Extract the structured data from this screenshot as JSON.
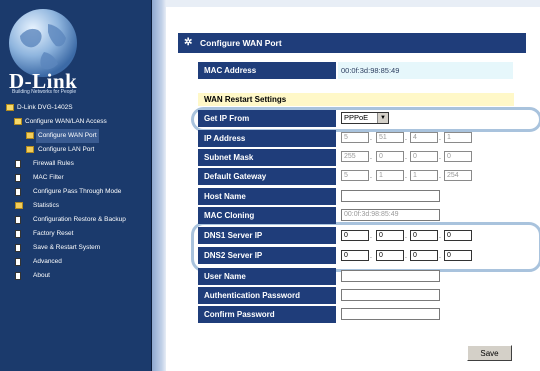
{
  "branding": {
    "logo": "D-Link",
    "tagline": "Building Networks for People"
  },
  "sidebar": {
    "items": [
      {
        "label": "D-Link DVG-1402S",
        "icon": "folder-open-icon"
      },
      {
        "label": "Configure WAN/LAN Access",
        "icon": "folder-open-icon"
      },
      {
        "label": "Configure WAN Port",
        "icon": "folder-icon",
        "selected": true
      },
      {
        "label": "Configure LAN Port",
        "icon": "folder-icon"
      },
      {
        "label": "Firewall Rules",
        "icon": "page-icon"
      },
      {
        "label": "MAC Filter",
        "icon": "page-icon"
      },
      {
        "label": "Configure Pass Through Mode",
        "icon": "page-icon"
      },
      {
        "label": "Statistics",
        "icon": "folder-icon"
      },
      {
        "label": "Configuration Restore & Backup",
        "icon": "page-icon"
      },
      {
        "label": "Factory Reset",
        "icon": "page-icon"
      },
      {
        "label": "Save & Restart System",
        "icon": "page-icon"
      },
      {
        "label": "Advanced",
        "icon": "page-icon"
      },
      {
        "label": "About",
        "icon": "page-icon"
      }
    ]
  },
  "panel": {
    "title": "Configure WAN Port",
    "mac_label": "MAC Address",
    "mac_value": "00:0f:3d:98:85:49",
    "section_title": "WAN Restart Settings",
    "fields": {
      "get_ip_from": {
        "label": "Get IP From",
        "value": "PPPoE"
      },
      "ip_address": {
        "label": "IP Address",
        "octets": [
          "5",
          "51",
          "4",
          "1"
        ]
      },
      "subnet_mask": {
        "label": "Subnet Mask",
        "octets": [
          "255",
          "0",
          "0",
          "0"
        ]
      },
      "default_gateway": {
        "label": "Default Gateway",
        "octets": [
          "5",
          "1",
          "1",
          "254"
        ]
      },
      "host_name": {
        "label": "Host Name",
        "value": ""
      },
      "mac_cloning": {
        "label": "MAC Cloning",
        "value": "00:0f:3d:98:85:49"
      },
      "dns1": {
        "label": "DNS1 Server IP",
        "octets": [
          "0",
          "0",
          "0",
          "0"
        ]
      },
      "dns2": {
        "label": "DNS2 Server IP",
        "octets": [
          "0",
          "0",
          "0",
          "0"
        ]
      },
      "user_name": {
        "label": "User Name",
        "value": ""
      },
      "auth_password": {
        "label": "Authentication Password",
        "value": ""
      },
      "confirm_password": {
        "label": "Confirm Password",
        "value": ""
      }
    },
    "save_label": "Save",
    "dot": "."
  },
  "colors": {
    "sidebar": "#1b3a6c",
    "label_bg": "#1f3d7a",
    "section_bg": "#fff8c8",
    "highlight": "#a9c3dd"
  }
}
